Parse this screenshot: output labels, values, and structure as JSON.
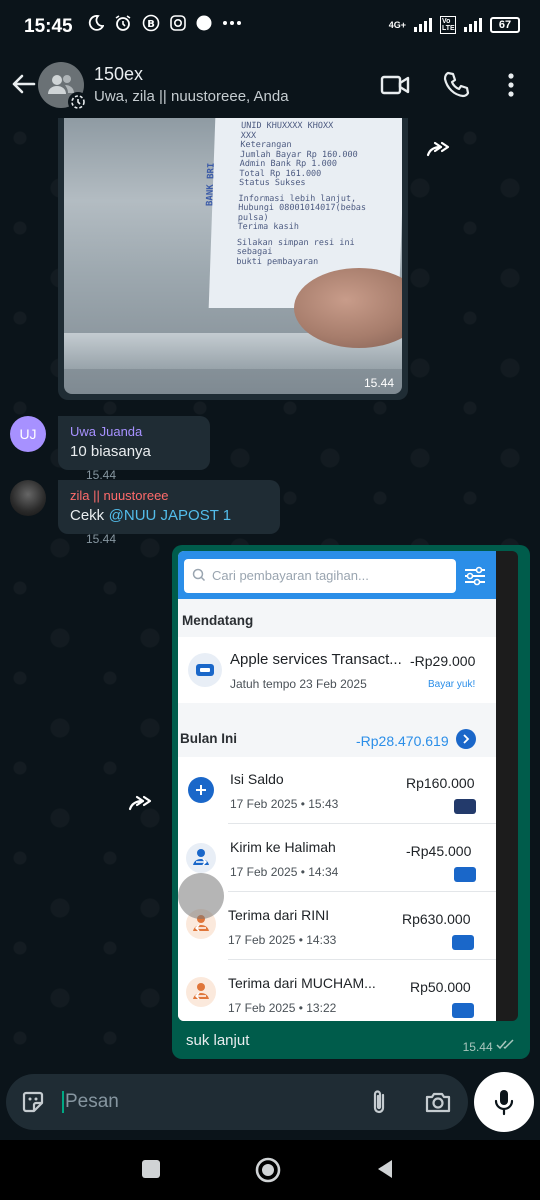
{
  "status_bar": {
    "time": "15:45",
    "network": "4G+",
    "volte": "Vo LTE",
    "battery": "67"
  },
  "header": {
    "title": "150ex",
    "subtitle": "Uwa, zila || nuustoreee, Anda"
  },
  "messages": {
    "receipt_photo": {
      "time": "15.44",
      "receipt_lines": [
        "UNID KHUXXXX KHOXX",
        "XXX",
        "Keterangan",
        "Jumlah Bayar   Rp 160.000",
        "Admin Bank     Rp 1.000",
        "Total          Rp 161.000",
        "Status         Sukses",
        "",
        "  Informasi lebih lanjut,",
        " Hubungi 08001014017(bebas",
        "          pulsa)",
        "      Terima kasih",
        "",
        "  Silakan simpan resi ini",
        "         sebagai",
        "   bukti pembayaran"
      ],
      "receipt_label": "BANK BRI"
    },
    "uwa": {
      "initials": "UJ",
      "sender": "Uwa Juanda",
      "text": "10 biasanya",
      "time": "15.44"
    },
    "zila": {
      "sender": "zila || nuustoreee",
      "text": "Cekk",
      "mention": "@NUU JAPOST 1",
      "time": "15.44"
    },
    "screenshot": {
      "search_placeholder": "Cari pembayaran tagihan...",
      "upcoming_label": "Mendatang",
      "upcoming": {
        "title": "Apple services Transact...",
        "date": "Jatuh tempo 23 Feb 2025",
        "amount": "-Rp29.000",
        "action": "Bayar yuk!"
      },
      "month_label": "Bulan Ini",
      "month_total": "-Rp28.470.619",
      "transactions": [
        {
          "title": "Isi Saldo",
          "date": "17 Feb 2025 • 15:43",
          "amount": "Rp160.000"
        },
        {
          "title": "Kirim ke Halimah",
          "date": "17 Feb 2025 • 14:34",
          "amount": "-Rp45.000"
        },
        {
          "title": "Terima dari RINI",
          "date": "17 Feb 2025 • 14:33",
          "amount": "Rp630.000"
        },
        {
          "title": "Terima dari MUCHAM...",
          "date": "17 Feb 2025 • 13:22",
          "amount": "Rp50.000"
        }
      ],
      "caption": "suk lanjut",
      "time": "15.44"
    }
  },
  "composer": {
    "placeholder": "Pesan"
  },
  "colors": {
    "background": "#0b141a",
    "incoming_bubble": "#1f2c34",
    "outgoing_bubble": "#005c4b",
    "accent": "#00a884",
    "uwa_name": "#a791ff",
    "zila_name": "#ff6b6b",
    "app_blue": "#2b8ee8"
  }
}
